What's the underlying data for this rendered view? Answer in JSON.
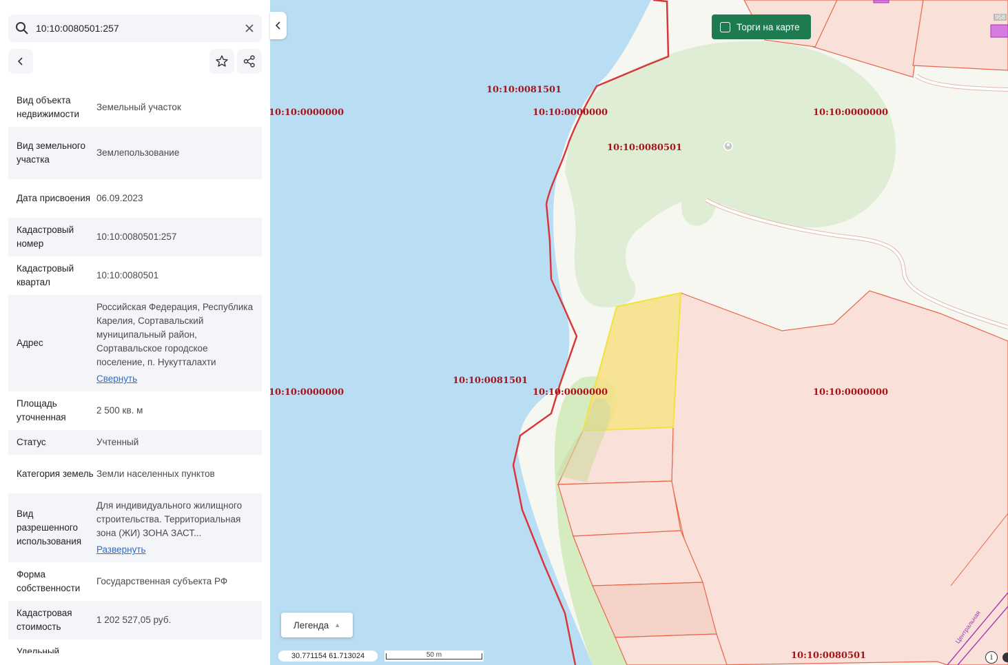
{
  "search": {
    "value": "10:10:0080501:257"
  },
  "details": [
    {
      "label": "Вид объекта недвижимости",
      "value": "Земельный участок"
    },
    {
      "label": "Вид земельного участка",
      "value": "Землепользование"
    },
    {
      "label": "Дата присвоения",
      "value": "06.09.2023"
    },
    {
      "label": "Кадастровый номер",
      "value": "10:10:0080501:257"
    },
    {
      "label": "Кадастровый квартал",
      "value": "10:10:0080501"
    },
    {
      "label": "Адрес",
      "value": "Российская Федерация, Республика Карелия, Сортавальский муниципальный район, Сортавальское городское поселение, п. Нукутталахти",
      "link": "Свернуть"
    },
    {
      "label": "Площадь уточненная",
      "value": "2 500 кв. м"
    },
    {
      "label": "Статус",
      "value": "Учтенный"
    },
    {
      "label": "Категория земель",
      "value": "Земли населенных пунктов"
    },
    {
      "label": "Вид разрешенного использования",
      "value": "Для индивидуального жилищного строительства. Территориальная зона (ЖИ) ЗОНА ЗАСТ...",
      "link": "Развернуть"
    },
    {
      "label": "Форма собственности",
      "value": "Государственная субъекта РФ"
    },
    {
      "label": "Кадастровая стоимость",
      "value": "1 202 527,05 руб."
    },
    {
      "label": "Удельный",
      "value": ""
    }
  ],
  "map": {
    "torgi_label": "Торги на карте",
    "legend_label": "Легенда",
    "coord_lon": "30.771154",
    "coord_lat": "61.713024",
    "scale_label": "50 m",
    "info_label": "i",
    "corner_label": "958",
    "road_label": "Центральная",
    "labels": [
      "10:10:0081501",
      "10:10:0000000",
      "10:10:0000000",
      "10:10:0000000",
      "10:10:0080501",
      "10:10:0081501",
      "10:10:0000000",
      "10:10:0000000",
      "10:10:0000000",
      "10:10:0080501"
    ],
    "colors": {
      "water": "#b9def4",
      "land": "#f7f7f1",
      "forest": "#dfedd4",
      "parcel": "#f9e0d9",
      "parcel_border": "#e8654a",
      "selected": "#f5e08a",
      "boundary": "#d6373a",
      "button": "#1e7b4f",
      "label": "#a3141b"
    }
  }
}
